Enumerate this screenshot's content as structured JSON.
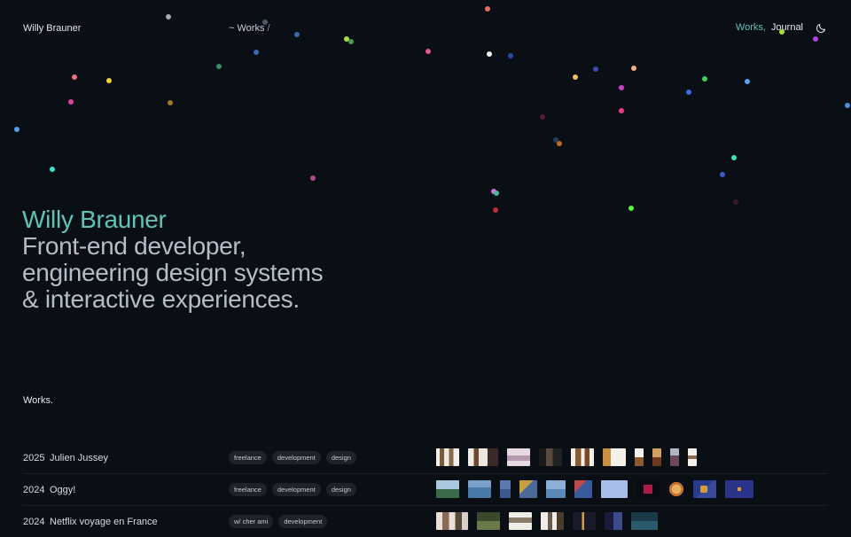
{
  "header": {
    "brand": "Willy Brauner",
    "breadcrumb_prefix": "~",
    "breadcrumb_current": "Works",
    "breadcrumb_sep": "/",
    "nav": [
      {
        "label": "Works",
        "active": true
      },
      {
        "label": "Journal",
        "active": false
      }
    ],
    "nav_comma": ",",
    "theme_toggle_icon": "moon-icon"
  },
  "hero": {
    "name": "Willy Brauner",
    "tagline_line1": "Front-end developer,",
    "tagline_line2": "engineering design systems",
    "tagline_line3": "& interactive experiences."
  },
  "works_label": "Works.",
  "works": [
    {
      "year": "2025",
      "title": "Julien Jussey",
      "tags": [
        "freelance",
        "development",
        "design"
      ]
    },
    {
      "year": "2024",
      "title": "Oggy!",
      "tags": [
        "freelance",
        "development",
        "design"
      ]
    },
    {
      "year": "2024",
      "title": "Netflix voyage en France",
      "tags": [
        "w/ cher ami",
        "development"
      ]
    }
  ],
  "colors": {
    "accent": "#62c2b7",
    "background": "#0a0e15",
    "muted_text": "#b6bcc7"
  }
}
